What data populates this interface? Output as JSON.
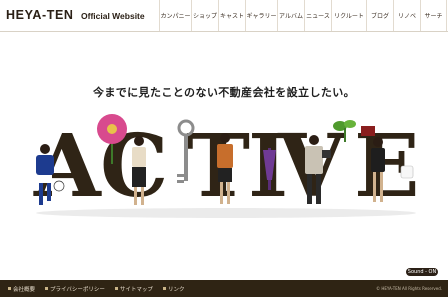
{
  "header": {
    "logo": "HEYA-TEN",
    "logo_sub": "Official Website",
    "nav": [
      "カンパニー",
      "ショップ",
      "キャスト",
      "ギャラリー",
      "アルバム",
      "ニュース",
      "リクルート",
      "ブログ",
      "リノベ",
      "サーチ"
    ]
  },
  "main": {
    "tagline": "今までに見たことのない不動産会社を設立したい。",
    "hero_word": [
      "A",
      "C",
      "T",
      "I",
      "V",
      "E"
    ]
  },
  "sound_label": "Sound - ON",
  "footer": {
    "links": [
      "会社概要",
      "プライバシーポリシー",
      "サイトマップ",
      "リンク"
    ],
    "copyright": "© HEYA-TEN All Rights Reserved."
  },
  "colors": {
    "brand_dark": "#2f2414",
    "letter": "#2f2416"
  }
}
